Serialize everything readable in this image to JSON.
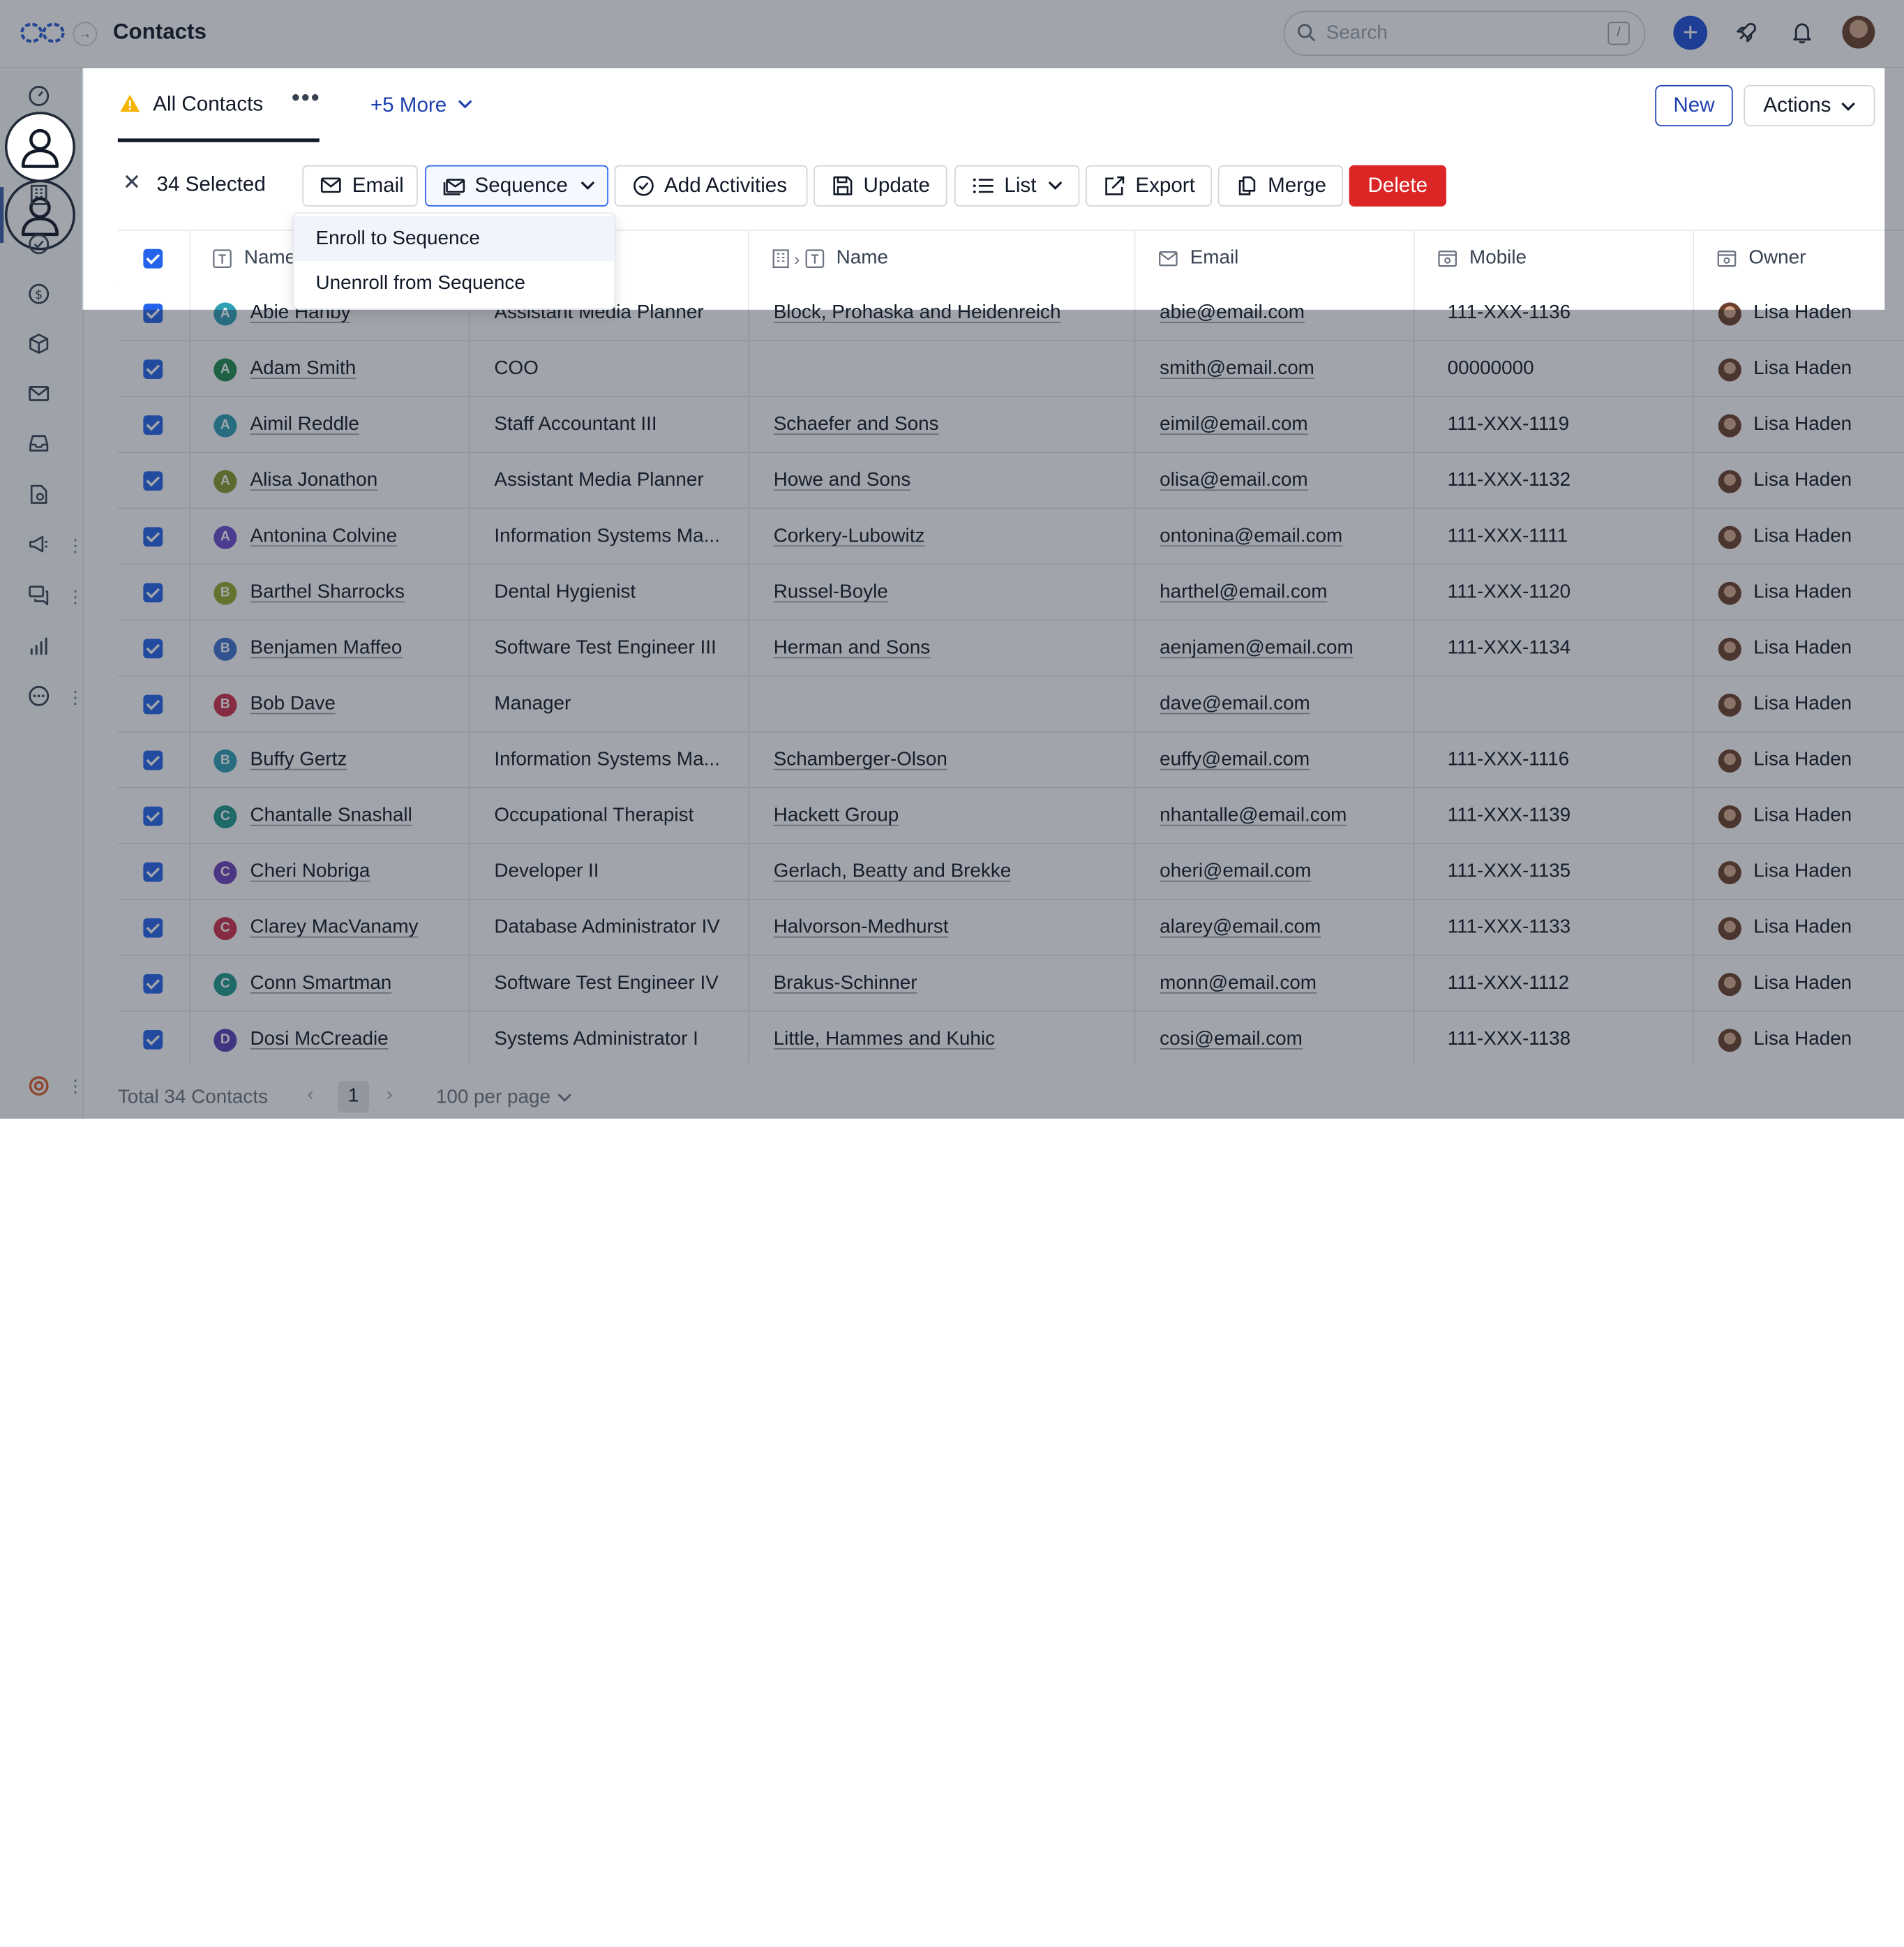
{
  "app": {
    "title": "Contacts"
  },
  "search": {
    "placeholder": "Search",
    "shortcut": "/"
  },
  "nav": {
    "items": [
      "dashboard-icon",
      "contacts-icon",
      "companies-icon",
      "tasks-icon",
      "deals-icon",
      "products-icon",
      "mail-icon",
      "inbox-icon",
      "documents-icon",
      "campaigns-icon",
      "conversations-icon",
      "reports-icon",
      "more-icon"
    ],
    "active": "contacts-icon"
  },
  "view": {
    "tab_label": "All Contacts",
    "more_label": "+5 More",
    "new_label": "New",
    "actions_label": "Actions"
  },
  "selection": {
    "count_label": "34 Selected"
  },
  "toolbar": {
    "email_label": "Email",
    "sequence_label": "Sequence",
    "add_activities_label": "Add Activities",
    "update_label": "Update",
    "list_label": "List",
    "export_label": "Export",
    "merge_label": "Merge",
    "delete_label": "Delete"
  },
  "sequence_menu": {
    "items": [
      "Enroll to Sequence",
      "Unenroll from Sequence"
    ],
    "highlighted": 0
  },
  "table": {
    "columns": [
      {
        "key": "name",
        "label": "Name"
      },
      {
        "key": "job_title",
        "label": ""
      },
      {
        "key": "company",
        "label": "Name"
      },
      {
        "key": "email",
        "label": "Email"
      },
      {
        "key": "mobile",
        "label": "Mobile"
      },
      {
        "key": "owner",
        "label": "Owner"
      }
    ],
    "rows": [
      {
        "initial": "A",
        "color": "#2f9fb3",
        "name": "Abie Hanby",
        "title": "Assistant Media Planner",
        "company": "Block, Prohaska and Heidenreich",
        "email": "abie@email.com",
        "mobile": "111-XXX-1136",
        "owner": "Lisa Haden"
      },
      {
        "initial": "A",
        "color": "#1f8a4c",
        "name": "Adam Smith",
        "title": "COO",
        "company": "",
        "email": "smith@email.com",
        "mobile": "00000000",
        "owner": "Lisa Haden"
      },
      {
        "initial": "A",
        "color": "#2f9fb3",
        "name": "Aimil Reddle",
        "title": "Staff Accountant III",
        "company": "Schaefer and Sons",
        "email": "eimil@email.com",
        "mobile": "111-XXX-1119",
        "owner": "Lisa Haden"
      },
      {
        "initial": "A",
        "color": "#8a9a2a",
        "name": "Alisa Jonathon",
        "title": "Assistant Media Planner",
        "company": "Howe and Sons",
        "email": "olisa@email.com",
        "mobile": "111-XXX-1132",
        "owner": "Lisa Haden"
      },
      {
        "initial": "A",
        "color": "#6d4ad1",
        "name": "Antonina Colvine",
        "title": "Information Systems Ma...",
        "company": "Corkery-Lubowitz",
        "email": "ontonina@email.com",
        "mobile": "111-XXX-1111",
        "owner": "Lisa Haden"
      },
      {
        "initial": "B",
        "color": "#9aaa2a",
        "name": "Barthel Sharrocks",
        "title": "Dental Hygienist",
        "company": "Russel-Boyle",
        "email": "harthel@email.com",
        "mobile": "111-XXX-1120",
        "owner": "Lisa Haden"
      },
      {
        "initial": "B",
        "color": "#3f6fd1",
        "name": "Benjamen Maffeo",
        "title": "Software Test Engineer III",
        "company": "Herman and Sons",
        "email": "aenjamen@email.com",
        "mobile": "111-XXX-1134",
        "owner": "Lisa Haden"
      },
      {
        "initial": "B",
        "color": "#d12f4a",
        "name": "Bob Dave",
        "title": "Manager",
        "company": "",
        "email": "dave@email.com",
        "mobile": "",
        "owner": "Lisa Haden"
      },
      {
        "initial": "B",
        "color": "#2f9fb3",
        "name": "Buffy Gertz",
        "title": "Information Systems Ma...",
        "company": "Schamberger-Olson",
        "email": "euffy@email.com",
        "mobile": "111-XXX-1116",
        "owner": "Lisa Haden"
      },
      {
        "initial": "C",
        "color": "#1f9a8c",
        "name": "Chantalle Snashall",
        "title": "Occupational Therapist",
        "company": "Hackett Group",
        "email": "nhantalle@email.com",
        "mobile": "111-XXX-1139",
        "owner": "Lisa Haden"
      },
      {
        "initial": "C",
        "color": "#6d3fb8",
        "name": "Cheri Nobriga",
        "title": "Developer II",
        "company": "Gerlach, Beatty and Brekke",
        "email": "oheri@email.com",
        "mobile": "111-XXX-1135",
        "owner": "Lisa Haden"
      },
      {
        "initial": "C",
        "color": "#d12f4a",
        "name": "Clarey MacVanamy",
        "title": "Database Administrator IV",
        "company": "Halvorson-Medhurst",
        "email": "alarey@email.com",
        "mobile": "111-XXX-1133",
        "owner": "Lisa Haden"
      },
      {
        "initial": "C",
        "color": "#1f9a8c",
        "name": "Conn Smartman",
        "title": "Software Test Engineer IV",
        "company": "Brakus-Schinner",
        "email": "monn@email.com",
        "mobile": "111-XXX-1112",
        "owner": "Lisa Haden"
      },
      {
        "initial": "D",
        "color": "#5b3fb8",
        "name": "Dosi McCreadie",
        "title": "Systems Administrator I",
        "company": "Little, Hammes and Kuhic",
        "email": "cosi@email.com",
        "mobile": "111-XXX-1138",
        "owner": "Lisa Haden"
      }
    ]
  },
  "footer": {
    "total_label": "Total 34 Contacts",
    "page": "1",
    "per_page_label": "100 per page"
  },
  "colors": {
    "accent": "#1e40af",
    "danger": "#dc2626",
    "checkbox": "#2563eb",
    "warning": "#f5b301"
  }
}
